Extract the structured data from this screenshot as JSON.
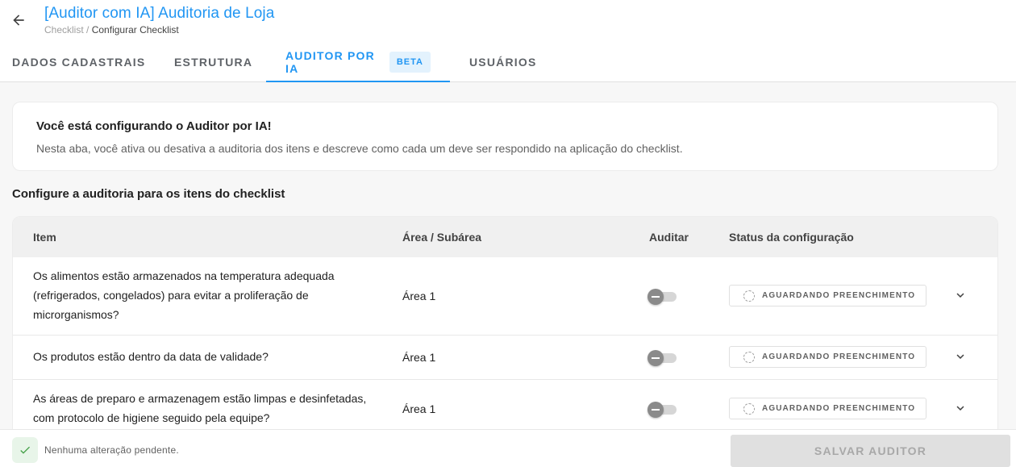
{
  "header": {
    "title": "[Auditor com IA] Auditoria de Loja",
    "breadcrumb": {
      "parent": "Checklist",
      "separator": "/",
      "current": "Configurar Checklist"
    }
  },
  "tabs": [
    {
      "label": "DADOS CADASTRAIS",
      "active": false
    },
    {
      "label": "ESTRUTURA",
      "active": false
    },
    {
      "label": "AUDITOR POR IA",
      "badge": "BETA",
      "active": true
    },
    {
      "label": "USUÁRIOS",
      "active": false
    }
  ],
  "info_card": {
    "title": "Você está configurando o Auditor por IA!",
    "description": "Nesta aba, você ativa ou desativa a auditoria dos itens e descreve como cada um deve ser respondido na aplicação do checklist."
  },
  "section_title": "Configure a auditoria para os itens do checklist",
  "table": {
    "columns": {
      "item": "Item",
      "area": "Área / Subárea",
      "audit": "Auditar",
      "status": "Status da configuração"
    },
    "rows": [
      {
        "item_lines": [
          "Os alimentos estão armazenados na temperatura adequada",
          "(refrigerados, congelados) para evitar a proliferação de",
          "microrganismos?"
        ],
        "area": "Área 1",
        "audit_enabled": false,
        "status": "AGUARDANDO PREENCHIMENTO"
      },
      {
        "item_lines": [
          "Os produtos estão dentro da data de validade?"
        ],
        "area": "Área 1",
        "audit_enabled": false,
        "status": "AGUARDANDO PREENCHIMENTO"
      },
      {
        "item_lines": [
          "As áreas de preparo e armazenagem estão limpas e desinfetadas,",
          "com protocolo de higiene seguido pela equipe?"
        ],
        "area": "Área 1",
        "audit_enabled": false,
        "status": "AGUARDANDO PREENCHIMENTO"
      }
    ]
  },
  "footer": {
    "status_text": "Nenhuma alteração pendente.",
    "save_label": "SALVAR AUDITOR"
  },
  "colors": {
    "accent": "#2196f3",
    "badge_bg": "#e3f2fd",
    "success_bg": "#e8f5e9",
    "success_icon": "#43a047",
    "disabled_button": "#e0e0e0"
  },
  "icons": {
    "back": "arrow-left-icon",
    "status": "dashed-circle-icon",
    "expand": "chevron-down-icon",
    "footer_check": "check-icon"
  }
}
